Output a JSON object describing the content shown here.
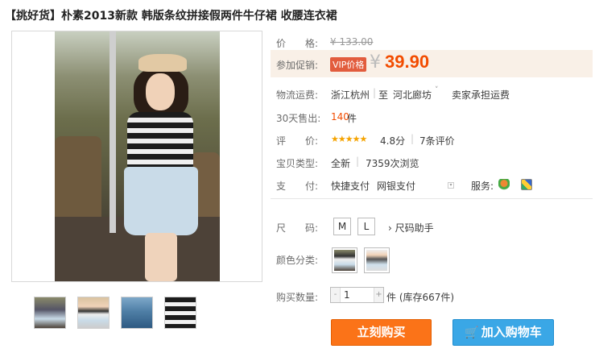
{
  "product": {
    "title": "【挑好货】朴素2013新款 韩版条纹拼接假两件牛仔裙 收腰连衣裙"
  },
  "price": {
    "label": "价　　格:",
    "original": "¥ 133.00"
  },
  "promo": {
    "label": "参加促销:",
    "badge": "VIP价格",
    "currency": "¥",
    "value": "39.90"
  },
  "shipping": {
    "label": "物流运费:",
    "origin": "浙江杭州",
    "to_prefix": "至",
    "destination": "河北廊坊",
    "dropdown": "˅",
    "fee": "卖家承担运费"
  },
  "sales": {
    "label": "30天售出:",
    "count": "140",
    "unit": "件"
  },
  "rating": {
    "label": "评　　价:",
    "stars": "★★★★★",
    "score": "4.8分",
    "reviews": "7条评价"
  },
  "item_type": {
    "label": "宝贝类型:",
    "condition": "全新",
    "views": "7359次浏览"
  },
  "payment": {
    "label": "支　　付:",
    "methods": [
      "快捷支付",
      "网银支付"
    ],
    "service_label": "服务:"
  },
  "size": {
    "label": "尺　　码:",
    "options": [
      "M",
      "L"
    ],
    "help": "› 尺码助手"
  },
  "color": {
    "label": "颜色分类:"
  },
  "quantity": {
    "label": "购买数量:",
    "value": "1",
    "minus": "-",
    "plus": "+",
    "stock_text": "件 (库存667件)"
  },
  "actions": {
    "buy_now": "立刻购买",
    "add_to_cart": "加入购物车",
    "cart_icon": "🛒"
  },
  "colors": {
    "price_orange": "#f24c00",
    "buy_button": "#fb7318",
    "cart_button": "#3aa7e6"
  }
}
